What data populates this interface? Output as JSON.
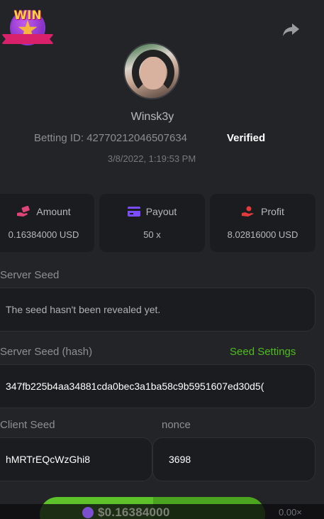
{
  "badge": {
    "text": "WIN"
  },
  "player": {
    "username": "Winsk3y",
    "betting_id_text": "Betting ID: 42770212046507634",
    "verified": "Verified",
    "timestamp": "3/8/2022, 1:19:53 PM"
  },
  "stats": {
    "amount": {
      "label": "Amount",
      "value": "0.16384000 USD",
      "icon": "money-hand-icon"
    },
    "payout": {
      "label": "Payout",
      "value": "50 x",
      "icon": "card-icon"
    },
    "profit": {
      "label": "Profit",
      "value": "8.02816000 USD",
      "icon": "profit-hand-icon"
    }
  },
  "server_seed": {
    "label": "Server Seed",
    "value": "The seed hasn't been revealed yet."
  },
  "server_seed_hash": {
    "label": "Server Seed (hash)",
    "settings_link": "Seed Settings",
    "value": "347fb225b4aa34881cda0bec3a1ba58c9b5951607ed30d5("
  },
  "client_seed": {
    "label": "Client Seed",
    "value": "hMRTrEQcWzGhi8"
  },
  "nonce": {
    "label": "nonce",
    "value": "3698"
  },
  "bottom_bar": {
    "amount": "$0.16384000",
    "multiplier": "0.00×"
  },
  "colors": {
    "background": "#232427",
    "card": "#1b1c1f",
    "accent_green": "#4fbc1f",
    "amount_icon": "#e0457a",
    "payout_icon": "#7c4dff",
    "profit_icon": "#e33b3b"
  }
}
